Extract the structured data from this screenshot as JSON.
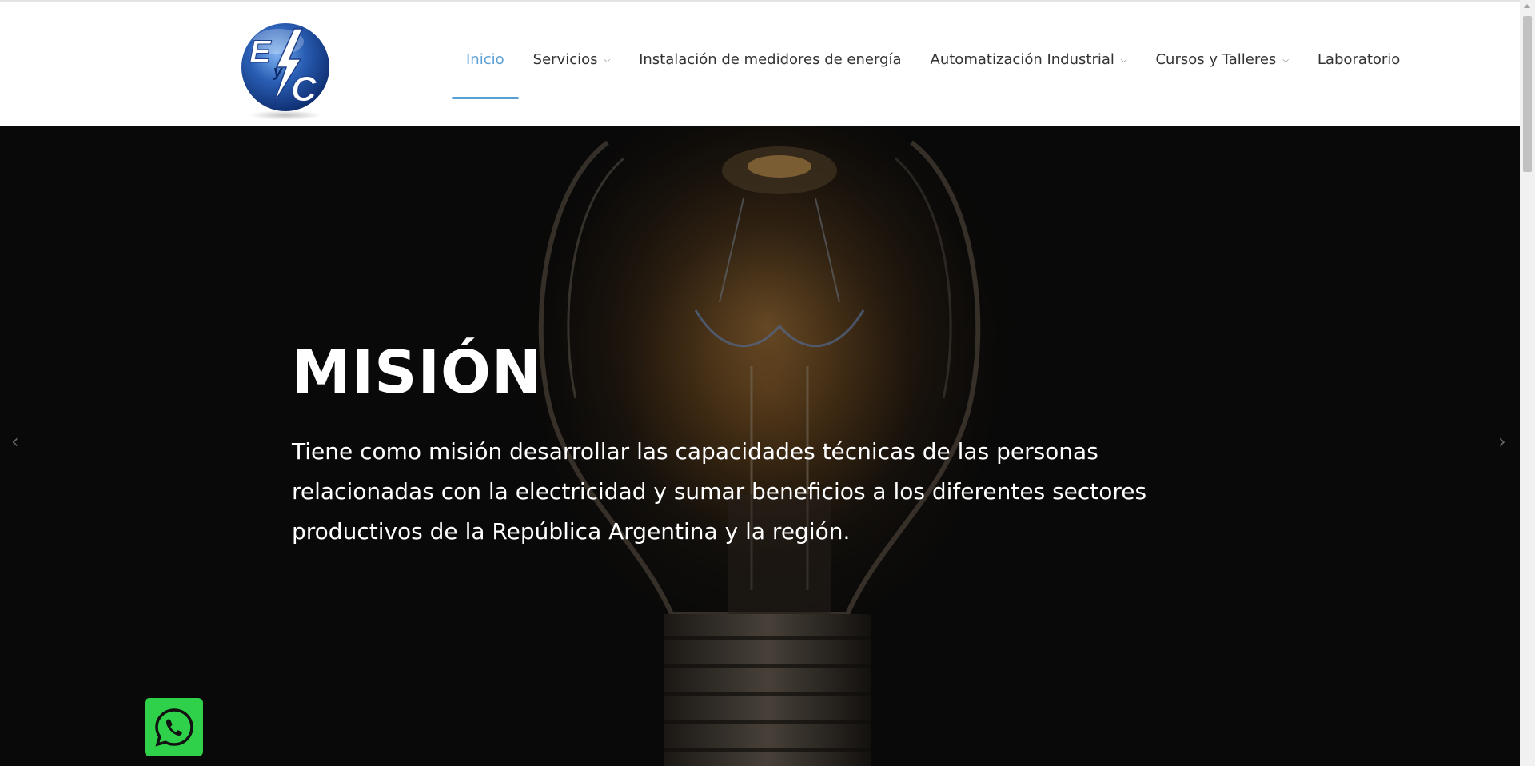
{
  "header": {
    "logo_letters": "EyC",
    "nav": [
      {
        "label": "Inicio",
        "active": true,
        "dropdown": false
      },
      {
        "label": "Servicios",
        "active": false,
        "dropdown": true
      },
      {
        "label": "Instalación de medidores de energía",
        "active": false,
        "dropdown": false
      },
      {
        "label": "Automatización Industrial",
        "active": false,
        "dropdown": true
      },
      {
        "label": "Cursos y Talleres",
        "active": false,
        "dropdown": true
      },
      {
        "label": "Laboratorio",
        "active": false,
        "dropdown": false
      }
    ],
    "accent_color": "#5a9fd4"
  },
  "hero": {
    "title": "MISIÓN",
    "text": "Tiene como misión desarrollar las capacidades técnicas de las personas relacionadas con la electricidad y sumar beneficios a los diferentes sectores productivos de la República Argentina y la región.",
    "prev_icon": "chevron-left-icon",
    "next_icon": "chevron-right-icon"
  },
  "whatsapp": {
    "icon": "whatsapp-icon",
    "color": "#2fd14b"
  }
}
